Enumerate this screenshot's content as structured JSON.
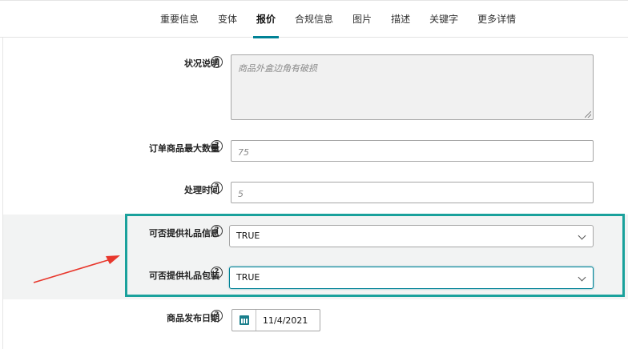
{
  "tabs": [
    {
      "label": "重要信息"
    },
    {
      "label": "变体"
    },
    {
      "label": "报价",
      "active": true
    },
    {
      "label": "合规信息"
    },
    {
      "label": "图片"
    },
    {
      "label": "描述"
    },
    {
      "label": "关键字"
    },
    {
      "label": "更多详情"
    }
  ],
  "form": {
    "condition_note": {
      "label": "状况说明",
      "placeholder": "商品外盒边角有破损"
    },
    "max_order_qty": {
      "label": "订单商品最大数量",
      "placeholder": "75"
    },
    "handling_time": {
      "label": "处理时间",
      "placeholder": "5"
    },
    "gift_message": {
      "label": "可否提供礼品信息",
      "value": "TRUE"
    },
    "gift_wrap": {
      "label": "可否提供礼品包装",
      "value": "TRUE"
    },
    "release_date": {
      "label": "商品发布日期",
      "value": "11/4/2021"
    }
  },
  "help_glyph": "?",
  "colors": {
    "accent": "#008296",
    "highlight": "#1aa19c",
    "arrow": "#e8372c"
  }
}
